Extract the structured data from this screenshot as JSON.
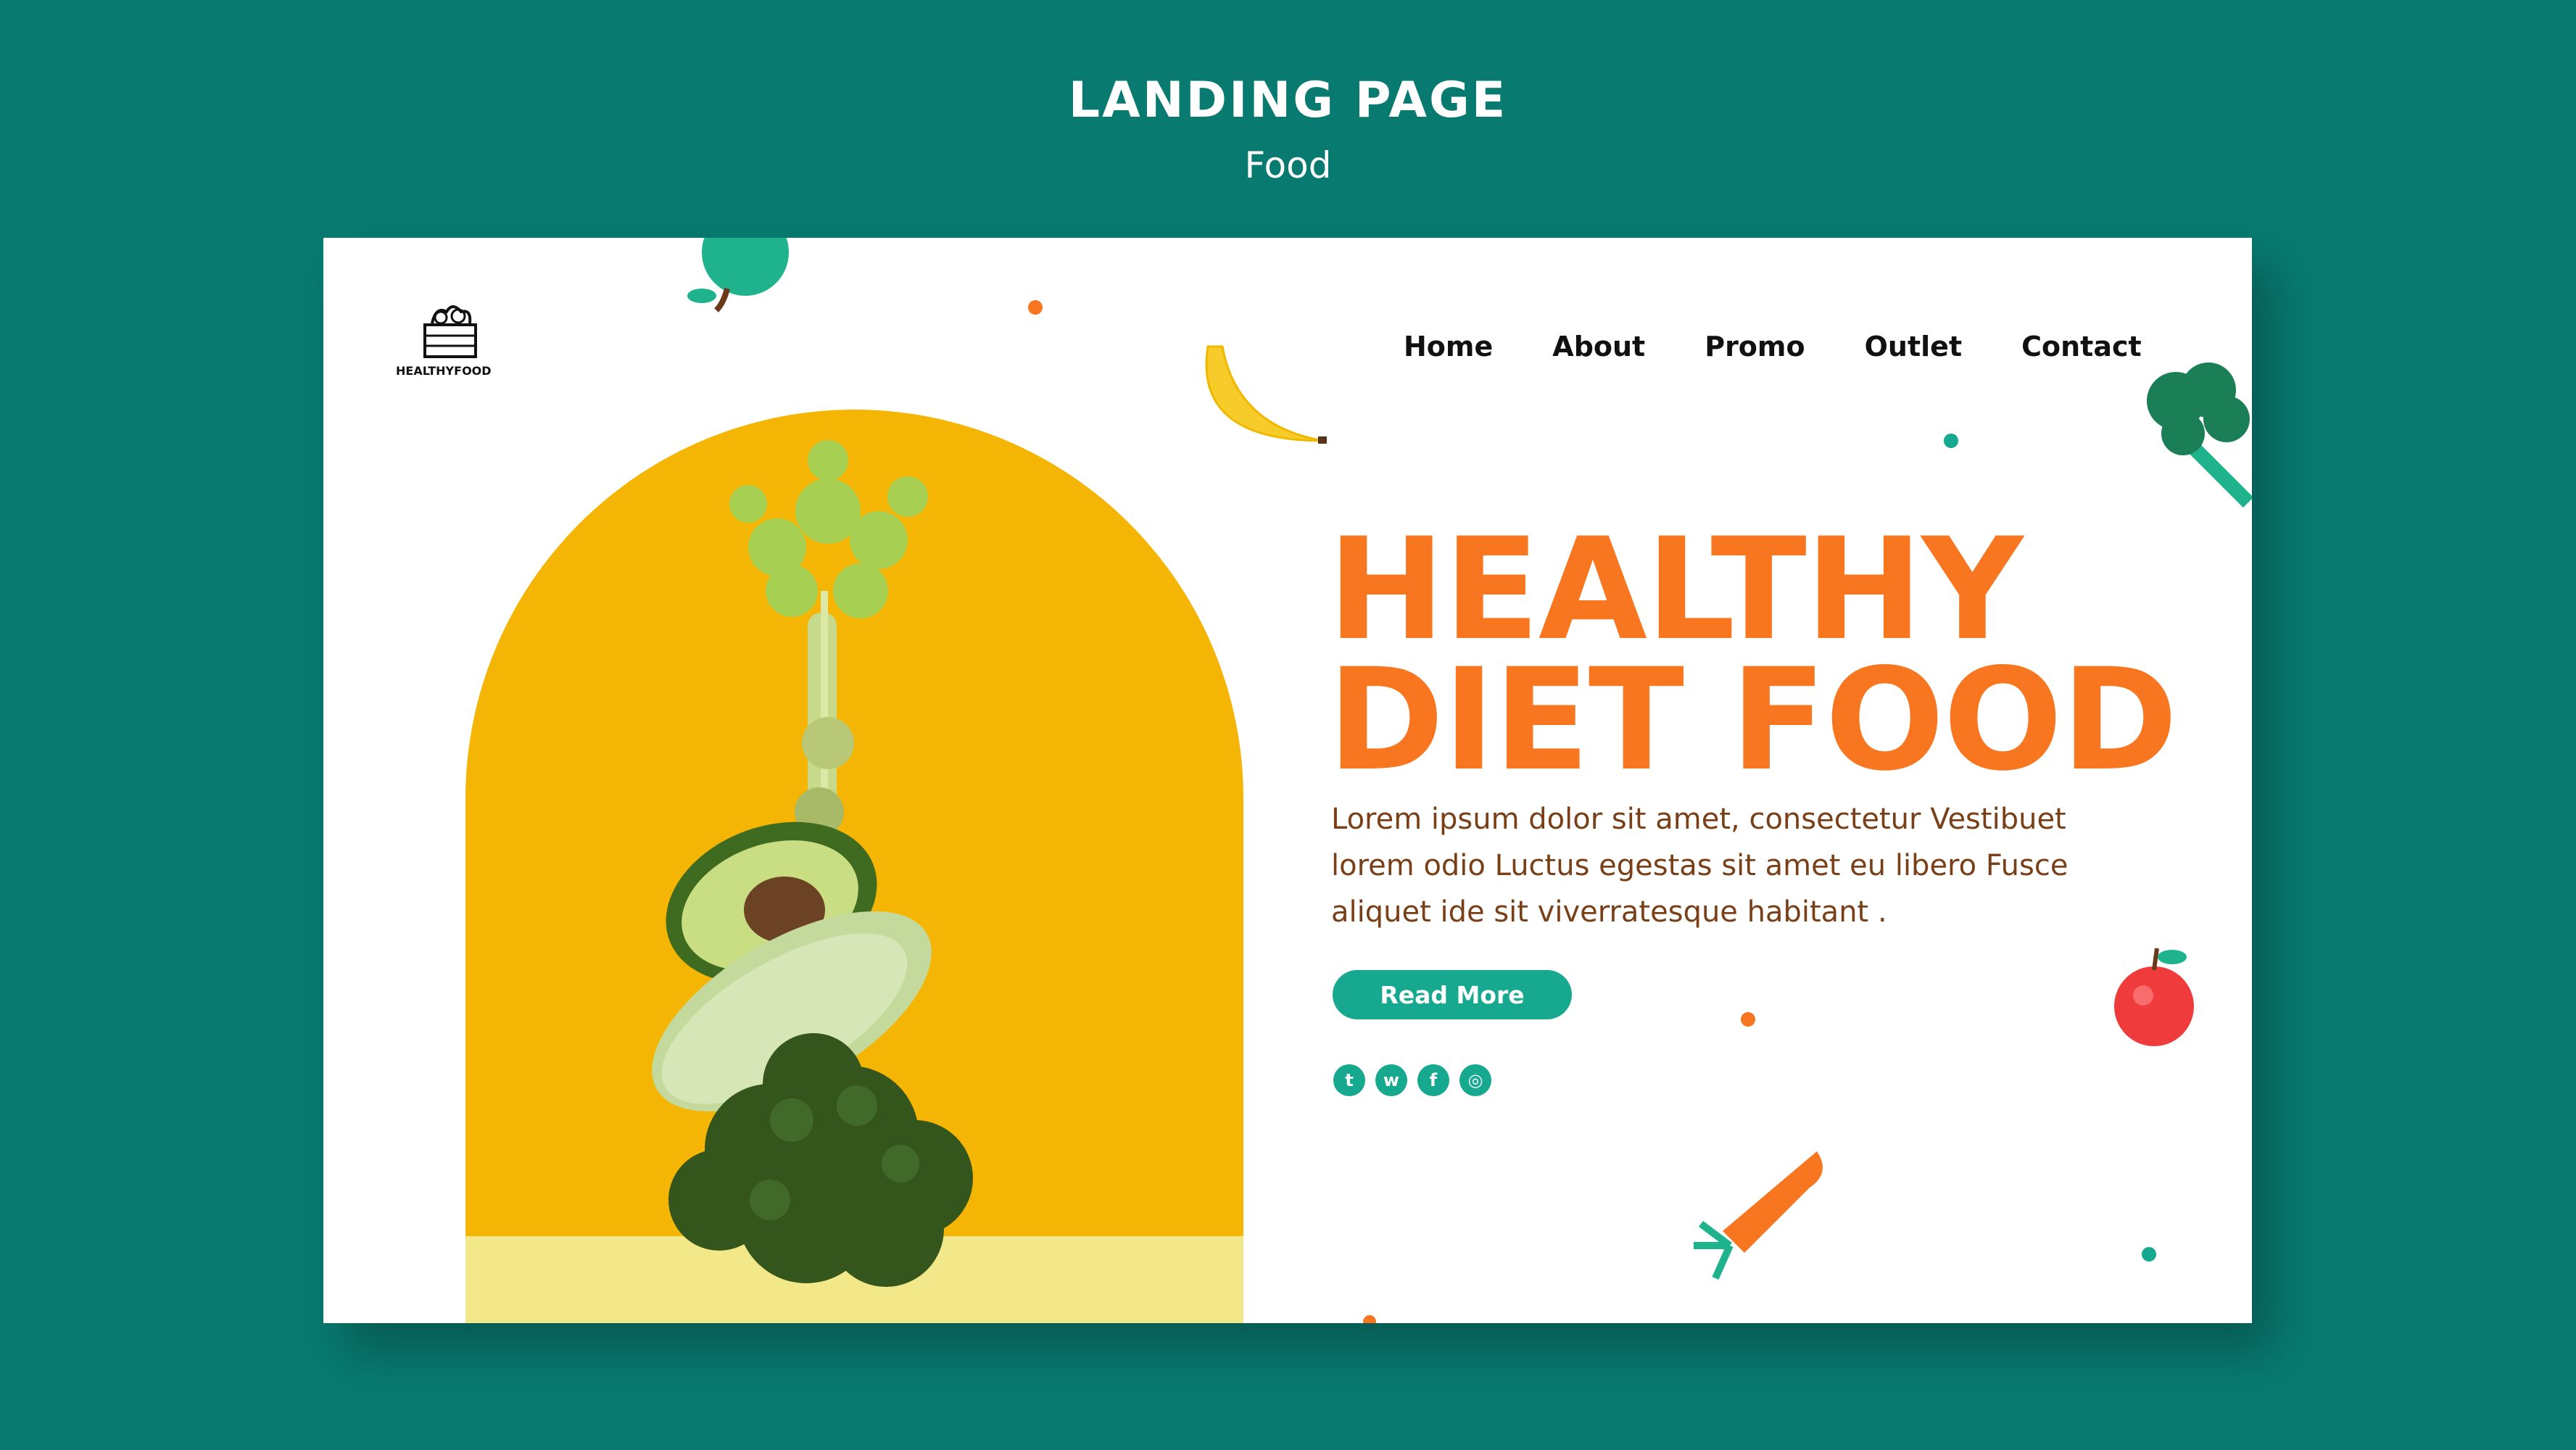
{
  "header": {
    "title": "LANDING PAGE",
    "subtitle": "Food"
  },
  "brand": {
    "logo_text": "HEALTHYFOOD",
    "logo_icon": "veggie-crate-icon"
  },
  "nav": {
    "items": [
      {
        "label": "Home"
      },
      {
        "label": "About"
      },
      {
        "label": "Promo"
      },
      {
        "label": "Outlet"
      },
      {
        "label": "Contact"
      }
    ]
  },
  "hero": {
    "headline_line1": "HEALTHY",
    "headline_line2": "DIET FOOD",
    "description": "Lorem ipsum dolor sit amet, consectetur Vestibuet lorem odio Luctus egestas sit amet eu libero Fusce aliquet ide sit viverratesque habitant .",
    "cta_label": "Read More",
    "image": "stacked-vegetables-photo"
  },
  "social": [
    {
      "icon": "twitter-icon",
      "glyph": "t"
    },
    {
      "icon": "whatsapp-icon",
      "glyph": "w"
    },
    {
      "icon": "facebook-icon",
      "glyph": "f"
    },
    {
      "icon": "instagram-icon",
      "glyph": "◎"
    }
  ],
  "decorations": [
    "apple-icon",
    "banana-icon",
    "broccoli-icon",
    "red-apple-icon",
    "carrot-icon"
  ],
  "colors": {
    "background": "#087a70",
    "accent_orange": "#f7761f",
    "accent_teal": "#16a98f",
    "arch_yellow": "#f5b505",
    "text_brown": "#7a3f16"
  }
}
